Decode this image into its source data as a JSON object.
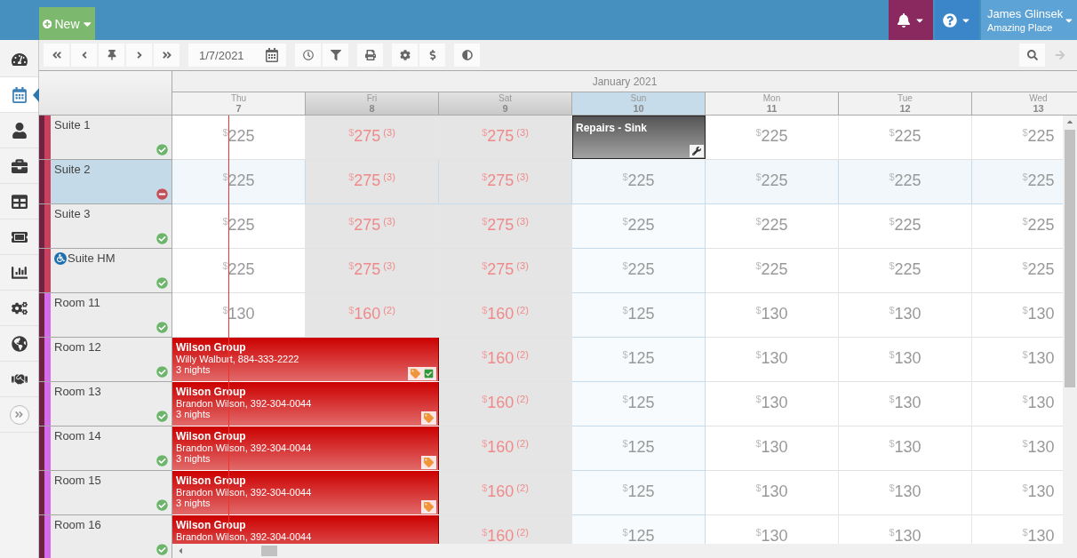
{
  "top_bar": {
    "new_label": "New",
    "user_name": "James Glinsek",
    "user_place": "Amazing Place"
  },
  "sidebar": {
    "items": [
      {
        "kind": "dashboard",
        "selected": false
      },
      {
        "kind": "calendar",
        "selected": true
      },
      {
        "kind": "guests",
        "selected": false
      },
      {
        "kind": "briefcase",
        "selected": false
      },
      {
        "kind": "table",
        "selected": false
      },
      {
        "kind": "ticket",
        "selected": false
      },
      {
        "kind": "chart",
        "selected": false
      },
      {
        "kind": "settings",
        "selected": false
      },
      {
        "kind": "globe",
        "selected": false
      },
      {
        "kind": "handshake",
        "selected": false
      },
      {
        "kind": "expand",
        "selected": false
      }
    ]
  },
  "toolbar": {
    "date_value": "1/7/2021",
    "forward": {
      "disabled": true
    }
  },
  "calendar": {
    "month": "January 2021",
    "days": [
      {
        "weekday": "Thu",
        "date": "7",
        "weekend": false,
        "selected": false
      },
      {
        "weekday": "Fri",
        "date": "8",
        "weekend": true,
        "selected": false
      },
      {
        "weekday": "Sat",
        "date": "9",
        "weekend": true,
        "selected": false
      },
      {
        "weekday": "Sun",
        "date": "10",
        "weekend": false,
        "selected": true
      },
      {
        "weekday": "Mon",
        "date": "11",
        "weekend": false,
        "selected": false
      },
      {
        "weekday": "Tue",
        "date": "12",
        "weekend": false,
        "selected": false
      },
      {
        "weekday": "Wed",
        "date": "13",
        "weekend": false,
        "selected": false
      }
    ],
    "rows": [
      {
        "name": "Suite 1",
        "color": "#c8405e",
        "available": true,
        "accessible": false,
        "selected": false,
        "cells": [
          {
            "kind": "rate",
            "currency": "$",
            "amount": "225"
          },
          {
            "kind": "rate",
            "currency": "$",
            "amount": "275",
            "count": "(3)"
          },
          {
            "kind": "rate",
            "currency": "$",
            "amount": "275",
            "count": "(3)"
          },
          {
            "kind": "block",
            "title": "Repairs - Sink"
          },
          {
            "kind": "rate",
            "currency": "$",
            "amount": "225"
          },
          {
            "kind": "rate",
            "currency": "$",
            "amount": "225"
          },
          {
            "kind": "rate",
            "currency": "$",
            "amount": "225"
          }
        ]
      },
      {
        "name": "Suite 2",
        "color": "#c8405e",
        "available": false,
        "accessible": false,
        "selected": true,
        "cells": [
          {
            "kind": "rate",
            "currency": "$",
            "amount": "225"
          },
          {
            "kind": "rate",
            "currency": "$",
            "amount": "275",
            "count": "(3)"
          },
          {
            "kind": "rate",
            "currency": "$",
            "amount": "275",
            "count": "(3)"
          },
          {
            "kind": "rate",
            "currency": "$",
            "amount": "225"
          },
          {
            "kind": "rate",
            "currency": "$",
            "amount": "225"
          },
          {
            "kind": "rate",
            "currency": "$",
            "amount": "225"
          },
          {
            "kind": "rate",
            "currency": "$",
            "amount": "225"
          }
        ]
      },
      {
        "name": "Suite 3",
        "color": "#c8405e",
        "available": true,
        "accessible": false,
        "selected": false,
        "cells": [
          {
            "kind": "rate",
            "currency": "$",
            "amount": "225"
          },
          {
            "kind": "rate",
            "currency": "$",
            "amount": "275",
            "count": "(3)"
          },
          {
            "kind": "rate",
            "currency": "$",
            "amount": "275",
            "count": "(3)"
          },
          {
            "kind": "rate",
            "currency": "$",
            "amount": "225"
          },
          {
            "kind": "rate",
            "currency": "$",
            "amount": "225"
          },
          {
            "kind": "rate",
            "currency": "$",
            "amount": "225"
          },
          {
            "kind": "rate",
            "currency": "$",
            "amount": "225"
          }
        ]
      },
      {
        "name": "Suite HM",
        "color": "#c8405e",
        "available": true,
        "accessible": true,
        "selected": false,
        "cells": [
          {
            "kind": "rate",
            "currency": "$",
            "amount": "225"
          },
          {
            "kind": "rate",
            "currency": "$",
            "amount": "275",
            "count": "(3)"
          },
          {
            "kind": "rate",
            "currency": "$",
            "amount": "275",
            "count": "(3)"
          },
          {
            "kind": "rate",
            "currency": "$",
            "amount": "225"
          },
          {
            "kind": "rate",
            "currency": "$",
            "amount": "225"
          },
          {
            "kind": "rate",
            "currency": "$",
            "amount": "225"
          },
          {
            "kind": "rate",
            "currency": "$",
            "amount": "225"
          }
        ]
      },
      {
        "name": "Room 11",
        "color": "#d56be8",
        "available": true,
        "accessible": false,
        "selected": false,
        "cells": [
          {
            "kind": "rate",
            "currency": "$",
            "amount": "130"
          },
          {
            "kind": "rate",
            "currency": "$",
            "amount": "160",
            "count": "(2)"
          },
          {
            "kind": "rate",
            "currency": "$",
            "amount": "160",
            "count": "(2)"
          },
          {
            "kind": "rate",
            "currency": "$",
            "amount": "125"
          },
          {
            "kind": "rate",
            "currency": "$",
            "amount": "130"
          },
          {
            "kind": "rate",
            "currency": "$",
            "amount": "130"
          },
          {
            "kind": "rate",
            "currency": "$",
            "amount": "130"
          }
        ]
      },
      {
        "name": "Room 12",
        "color": "#d56be8",
        "available": true,
        "accessible": false,
        "selected": false,
        "cells": [
          {
            "kind": "booking",
            "title": "Wilson Group",
            "guest": "Willy Walburt, 884-333-2222",
            "nights": "3 nights",
            "checked_in": true
          },
          {
            "kind": "continued"
          },
          {
            "kind": "rate",
            "currency": "$",
            "amount": "160",
            "count": "(2)"
          },
          {
            "kind": "rate",
            "currency": "$",
            "amount": "125"
          },
          {
            "kind": "rate",
            "currency": "$",
            "amount": "130"
          },
          {
            "kind": "rate",
            "currency": "$",
            "amount": "130"
          },
          {
            "kind": "rate",
            "currency": "$",
            "amount": "130"
          }
        ]
      },
      {
        "name": "Room 13",
        "color": "#d56be8",
        "available": true,
        "accessible": false,
        "selected": false,
        "cells": [
          {
            "kind": "booking",
            "title": "Wilson Group",
            "guest": "Brandon Wilson, 392-304-0044",
            "nights": "3 nights",
            "checked_in": false
          },
          {
            "kind": "continued"
          },
          {
            "kind": "rate",
            "currency": "$",
            "amount": "160",
            "count": "(2)"
          },
          {
            "kind": "rate",
            "currency": "$",
            "amount": "125"
          },
          {
            "kind": "rate",
            "currency": "$",
            "amount": "130"
          },
          {
            "kind": "rate",
            "currency": "$",
            "amount": "130"
          },
          {
            "kind": "rate",
            "currency": "$",
            "amount": "130"
          }
        ]
      },
      {
        "name": "Room 14",
        "color": "#d56be8",
        "available": true,
        "accessible": false,
        "selected": false,
        "cells": [
          {
            "kind": "booking",
            "title": "Wilson Group",
            "guest": "Brandon Wilson, 392-304-0044",
            "nights": "3 nights",
            "checked_in": false
          },
          {
            "kind": "continued"
          },
          {
            "kind": "rate",
            "currency": "$",
            "amount": "160",
            "count": "(2)"
          },
          {
            "kind": "rate",
            "currency": "$",
            "amount": "125"
          },
          {
            "kind": "rate",
            "currency": "$",
            "amount": "130"
          },
          {
            "kind": "rate",
            "currency": "$",
            "amount": "130"
          },
          {
            "kind": "rate",
            "currency": "$",
            "amount": "130"
          }
        ]
      },
      {
        "name": "Room 15",
        "color": "#d56be8",
        "available": true,
        "accessible": false,
        "selected": false,
        "cells": [
          {
            "kind": "booking",
            "title": "Wilson Group",
            "guest": "Brandon Wilson, 392-304-0044",
            "nights": "3 nights",
            "checked_in": false
          },
          {
            "kind": "continued"
          },
          {
            "kind": "rate",
            "currency": "$",
            "amount": "160",
            "count": "(2)"
          },
          {
            "kind": "rate",
            "currency": "$",
            "amount": "125"
          },
          {
            "kind": "rate",
            "currency": "$",
            "amount": "130"
          },
          {
            "kind": "rate",
            "currency": "$",
            "amount": "130"
          },
          {
            "kind": "rate",
            "currency": "$",
            "amount": "130"
          }
        ]
      },
      {
        "name": "Room 16",
        "color": "#d56be8",
        "available": true,
        "accessible": false,
        "selected": false,
        "cells": [
          {
            "kind": "booking",
            "title": "Wilson Group",
            "guest": "Brandon Wilson, 392-304-0044"
          },
          {
            "kind": "continued"
          },
          {
            "kind": "rate",
            "currency": "$",
            "amount": "160",
            "count": "(2)"
          },
          {
            "kind": "rate",
            "currency": "$",
            "amount": "125"
          },
          {
            "kind": "rate",
            "currency": "$",
            "amount": "130"
          },
          {
            "kind": "rate",
            "currency": "$",
            "amount": "130"
          },
          {
            "kind": "rate",
            "currency": "$",
            "amount": "130"
          }
        ]
      }
    ]
  }
}
